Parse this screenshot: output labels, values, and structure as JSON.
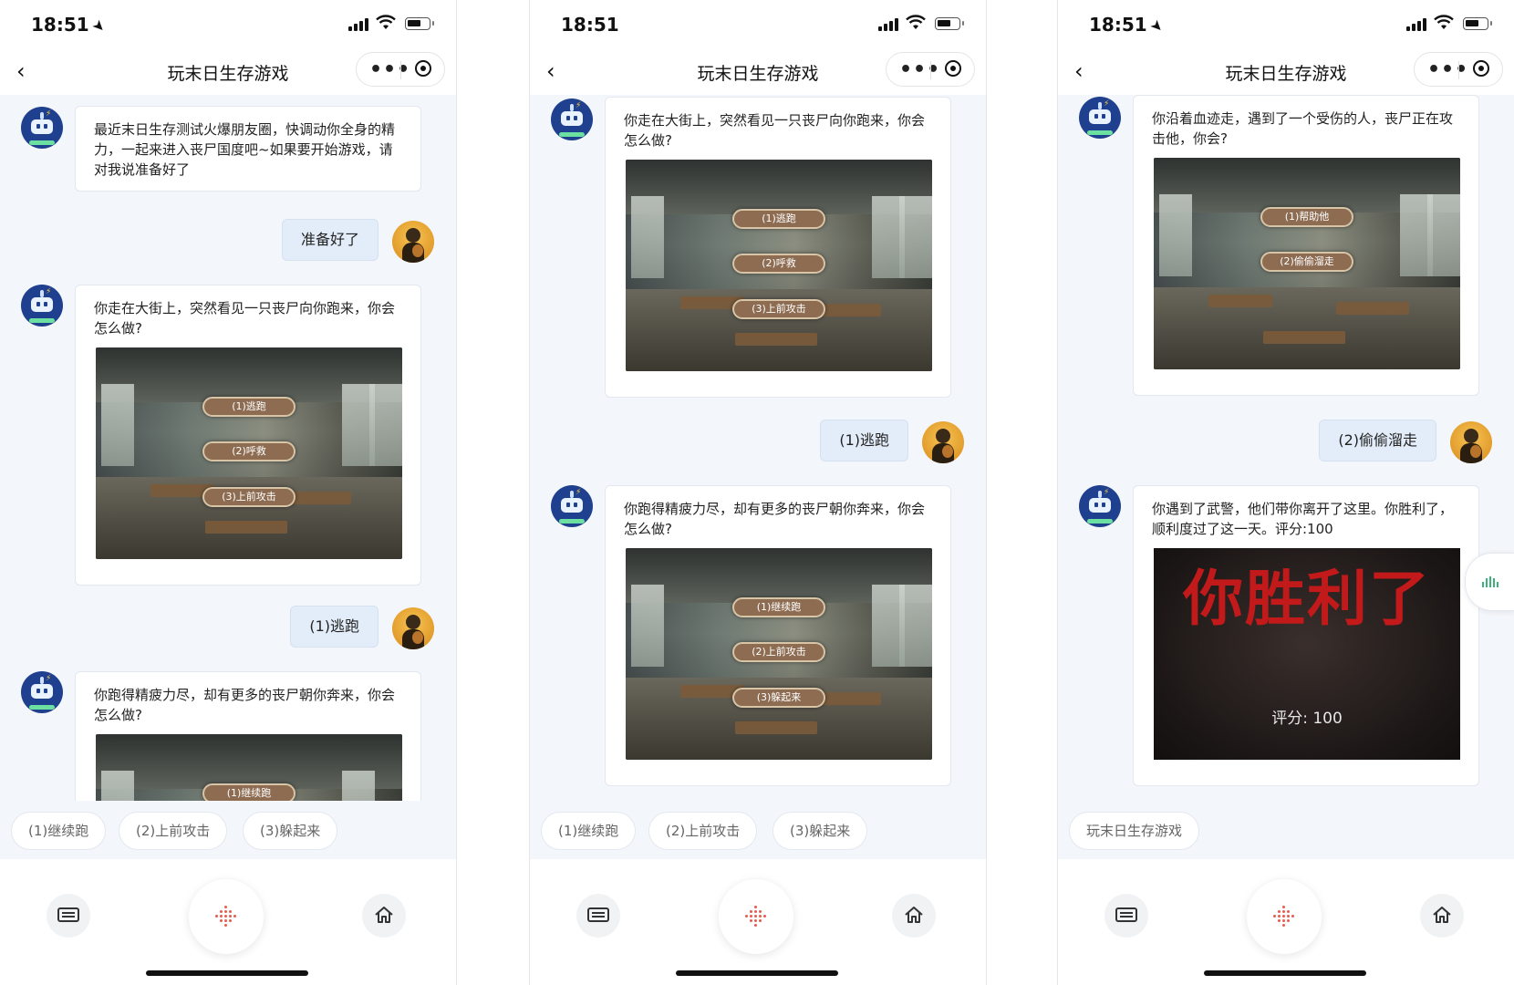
{
  "status": {
    "time": "18:51",
    "time_arrow": "➤"
  },
  "nav": {
    "title": "玩末日生存游戏",
    "back_icon": "‹",
    "more_icon": "•••"
  },
  "scene_options": {
    "s1": [
      "(1)逃跑",
      "(2)呼救",
      "(3)上前攻击"
    ],
    "s2": [
      "(1)继续跑",
      "(2)上前攻击",
      "(3)躲起来"
    ],
    "s3": [
      "(1)帮助他",
      "(2)偷偷溜走"
    ]
  },
  "screens": [
    {
      "messages": {
        "bot1": "最近末日生存测试火爆朋友圈，快调动你全身的精力，一起来进入丧尸国度吧~如果要开始游戏，请对我说准备好了",
        "user1": "准备好了",
        "bot2": "你走在大街上，突然看见一只丧尸向你跑来，你会怎么做?",
        "user2": "(1)逃跑",
        "bot3": "你跑得精疲力尽，却有更多的丧尸朝你奔来，你会怎么做?"
      },
      "chips": [
        "(1)继续跑",
        "(2)上前攻击",
        "(3)躲起来"
      ]
    },
    {
      "messages": {
        "bot1": "你走在大街上，突然看见一只丧尸向你跑来，你会怎么做?",
        "user1": "(1)逃跑",
        "bot2": "你跑得精疲力尽，却有更多的丧尸朝你奔来，你会怎么做?"
      },
      "chips": [
        "(1)继续跑",
        "(2)上前攻击",
        "(3)躲起来"
      ]
    },
    {
      "messages": {
        "bot1": "你沿着血迹走，遇到了一个受伤的人，丧尸正在攻击他，你会?",
        "user1": "(2)偷偷溜走",
        "bot2": "你遇到了武警，他们带你离开了这里。你胜利了，顺利度过了这一天。评分:100"
      },
      "win": {
        "title": "你胜利了",
        "score": "评分: 100"
      },
      "chips": [
        "玩末日生存游戏"
      ]
    }
  ],
  "colors": {
    "accent": "#e55b4f",
    "user_bubble": "#e3edf9",
    "chat_bg": "#f3f6fa",
    "win_text": "#c21a1a"
  }
}
